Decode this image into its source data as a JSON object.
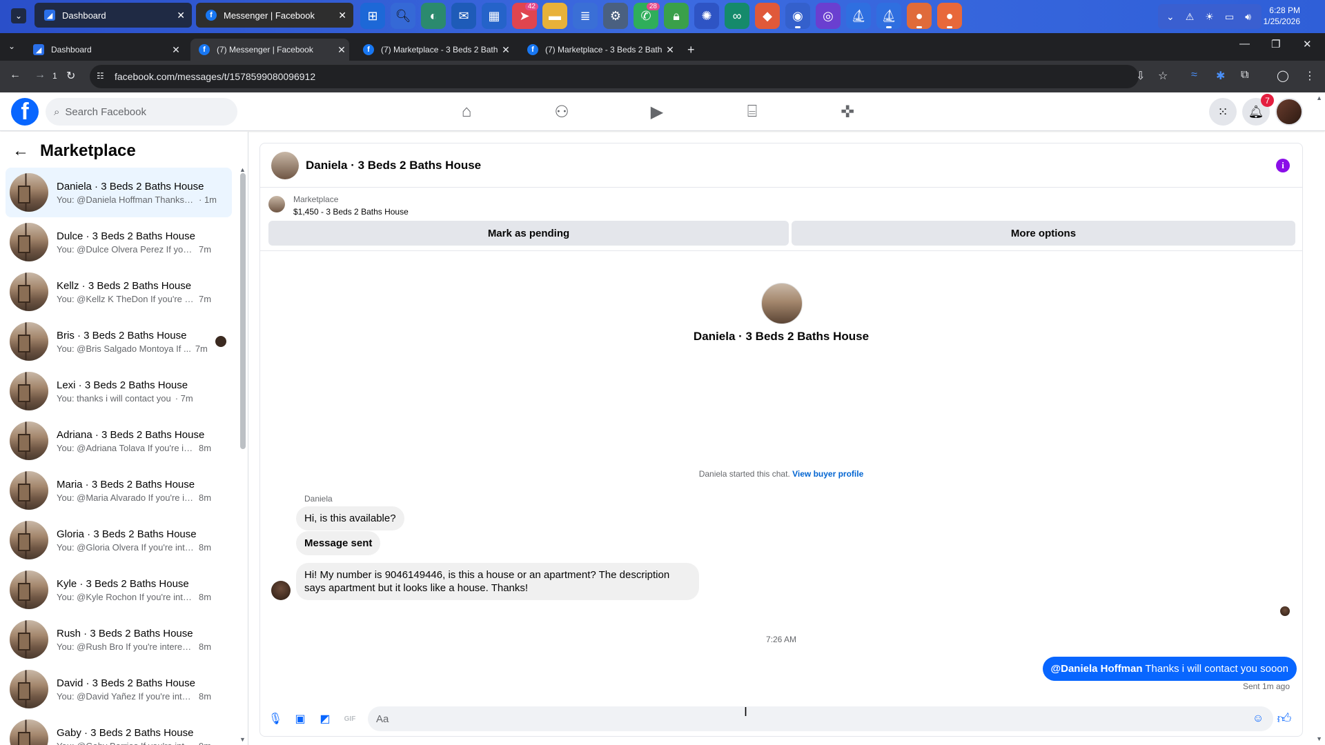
{
  "os": {
    "windows": [
      {
        "title": "Dashboard",
        "active": true
      },
      {
        "title": "Messenger | Facebook",
        "active": false
      }
    ],
    "app_badges": {
      "telegram": "42",
      "whatsapp": "28"
    },
    "clock": {
      "time": "6:28 PM",
      "date": "1/25/2026"
    }
  },
  "browser": {
    "tabs": [
      {
        "title": "Dashboard"
      },
      {
        "title": "(7) Messenger | Facebook"
      },
      {
        "title": "(7) Marketplace - 3 Beds 2 Bath"
      },
      {
        "title": "(7) Marketplace - 3 Beds 2 Bath"
      }
    ],
    "tab_count": "1",
    "url": "facebook.com/messages/t/1578599080096912"
  },
  "fb": {
    "search_placeholder": "Search Facebook",
    "notification_count": "7"
  },
  "sidebar": {
    "title": "Marketplace",
    "conversations": [
      {
        "name": "Daniela · 3 Beds 2 Baths House",
        "preview": "You: @Daniela Hoffman Thanks i ...",
        "time": "· 1m"
      },
      {
        "name": "Dulce · 3 Beds 2 Baths House",
        "preview": "You: @Dulce Olvera Perez If you're...",
        "time": "7m"
      },
      {
        "name": "Kellz · 3 Beds 2 Baths House",
        "preview": "You: @Kellz K TheDon If you're int...",
        "time": "7m"
      },
      {
        "name": "Bris · 3 Beds 2 Baths House",
        "preview": "You: @Bris Salgado Montoya If ...",
        "time": "7m"
      },
      {
        "name": "Lexi · 3 Beds 2 Baths House",
        "preview": "You: thanks i will contact you",
        "time": "· 7m"
      },
      {
        "name": "Adriana · 3 Beds 2 Baths House",
        "preview": "You: @Adriana Tolava If you're inte...",
        "time": "8m"
      },
      {
        "name": "Maria · 3 Beds 2 Baths House",
        "preview": "You: @Maria Alvarado If you're int...",
        "time": "8m"
      },
      {
        "name": "Gloria · 3 Beds 2 Baths House",
        "preview": "You: @Gloria Olvera If you're inter...",
        "time": "8m"
      },
      {
        "name": "Kyle · 3 Beds 2 Baths House",
        "preview": "You: @Kyle Rochon If you're intere...",
        "time": "8m"
      },
      {
        "name": "Rush · 3 Beds 2 Baths House",
        "preview": "You: @Rush Bro If you're intereste...",
        "time": "8m"
      },
      {
        "name": "David · 3 Beds 2 Baths House",
        "preview": "You: @David Yañez If you're intere...",
        "time": "8m"
      },
      {
        "name": "Gaby · 3 Beds 2 Baths House",
        "preview": "You: @Gaby Barrios If you're intere...",
        "time": "9m"
      }
    ]
  },
  "chat": {
    "title": "Daniela · 3 Beds 2 Baths House",
    "listing_source": "Marketplace",
    "listing_price": "$1,450 - 3 Beds 2 Baths House",
    "mark_pending_label": "Mark as pending",
    "more_options_label": "More options",
    "intro_name": "Daniela · 3 Beds 2 Baths House",
    "started_text": "Daniela started this chat.",
    "view_profile_label": "View buyer profile",
    "sender_name": "Daniela",
    "messages": [
      {
        "text": "Hi, is this available?"
      },
      {
        "text": "Message sent"
      },
      {
        "text": "Hi! My number is 9046149446, is this a house or an apartment? The description says apartment but it looks like a house. Thanks!"
      }
    ],
    "time_separator": "7:26 AM",
    "my_message_mention": "@Daniela Hoffman",
    "my_message_text": "Thanks i will contact you sooon",
    "sent_meta": "Sent 1m ago",
    "composer_placeholder": "Aa"
  }
}
